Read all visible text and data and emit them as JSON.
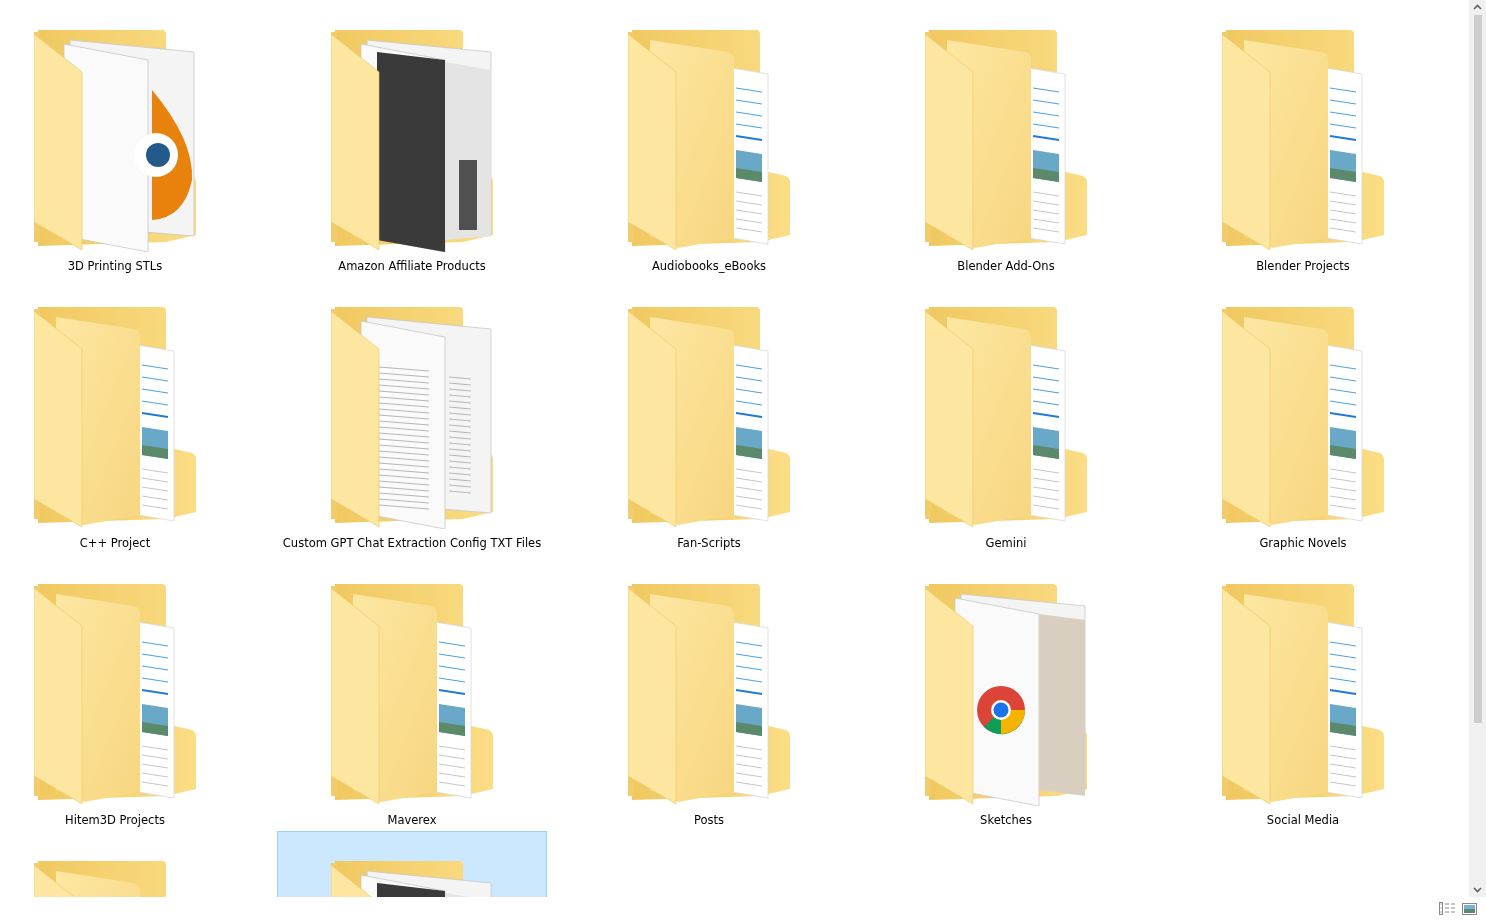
{
  "folders": [
    {
      "label": "3D Printing STLs",
      "kind": "emblem",
      "selected": false
    },
    {
      "label": "Amazon Affiliate Products",
      "kind": "photos",
      "selected": false
    },
    {
      "label": "Audiobooks_eBooks",
      "kind": "documents",
      "selected": false
    },
    {
      "label": "Blender Add-Ons",
      "kind": "documents",
      "selected": false
    },
    {
      "label": "Blender Projects",
      "kind": "documents",
      "selected": false
    },
    {
      "label": "C++ Project",
      "kind": "documents",
      "selected": false
    },
    {
      "label": "Custom GPT Chat Extraction Config TXT Files",
      "kind": "text",
      "selected": false
    },
    {
      "label": "Fan-Scripts",
      "kind": "documents",
      "selected": false
    },
    {
      "label": "Gemini",
      "kind": "documents",
      "selected": false
    },
    {
      "label": "Graphic Novels",
      "kind": "documents",
      "selected": false
    },
    {
      "label": "Hitem3D Projects",
      "kind": "documents",
      "selected": false
    },
    {
      "label": "Maverex",
      "kind": "documents",
      "selected": false
    },
    {
      "label": "Posts",
      "kind": "documents",
      "selected": false
    },
    {
      "label": "Sketches",
      "kind": "logo",
      "selected": false
    },
    {
      "label": "Social Media",
      "kind": "documents",
      "selected": false
    },
    {
      "kind": "documents",
      "selected": false
    },
    {
      "kind": "photos",
      "selected": true
    }
  ]
}
